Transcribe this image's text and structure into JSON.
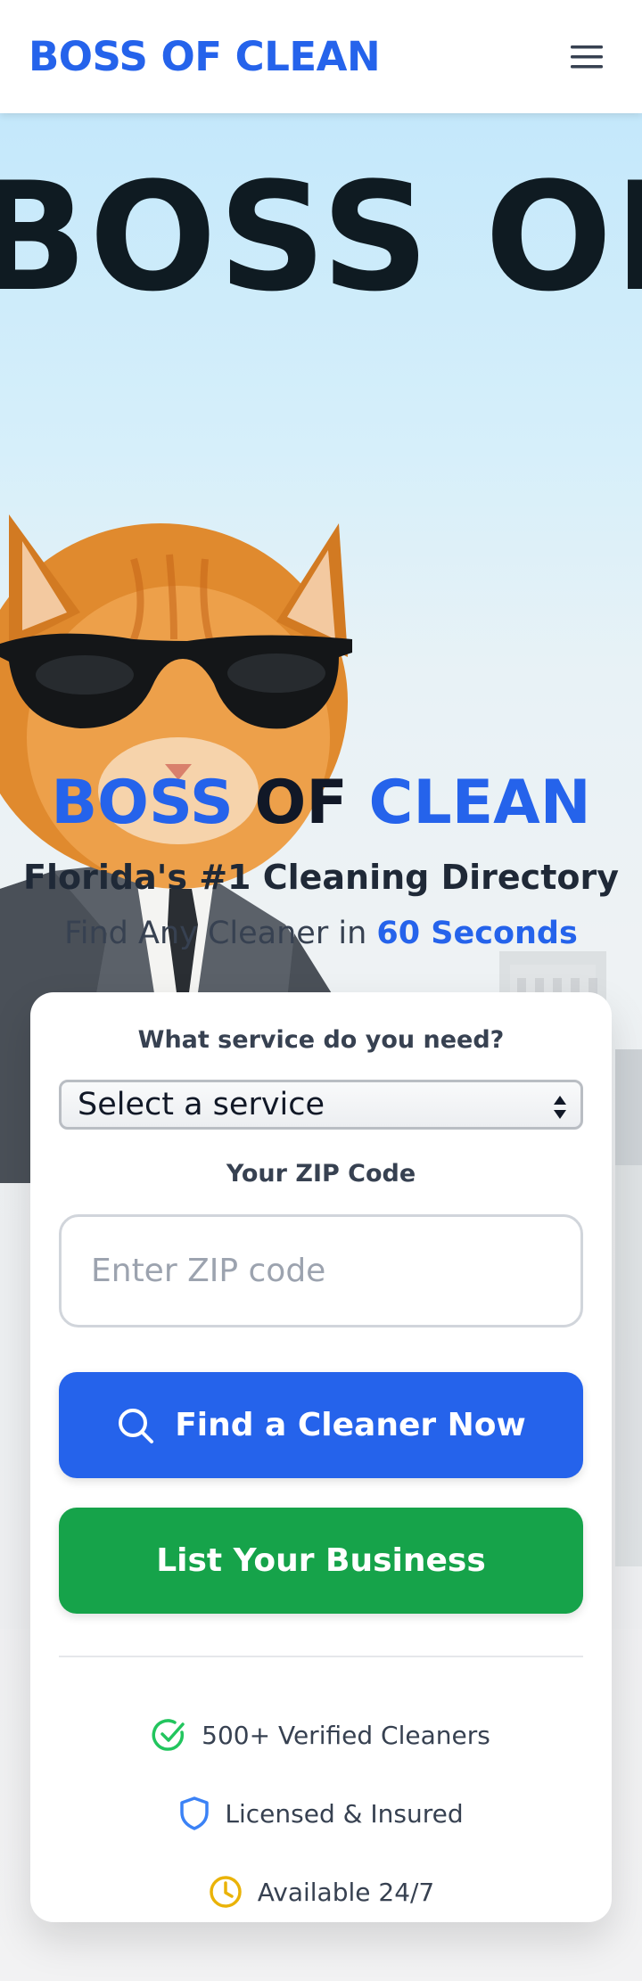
{
  "header": {
    "brand": "BOSS OF CLEAN",
    "menu_icon": "hamburger-menu-icon"
  },
  "hero": {
    "marquee_text": "BOSS OF CLEAN",
    "title_part1": "BOSS",
    "title_part2": " OF ",
    "title_part3": "CLEAN",
    "subtitle": "Florida's #1 Cleaning Directory",
    "tagline_prefix": "Find Any Cleaner in ",
    "tagline_highlight": "60 Seconds"
  },
  "form": {
    "service_label": "What service do you need?",
    "service_selected": "Select a service",
    "zip_label": "Your ZIP Code",
    "zip_placeholder": "Enter ZIP code",
    "zip_value": "",
    "find_button": "Find a Cleaner Now",
    "find_icon": "search-icon",
    "list_button": "List Your Business"
  },
  "features": [
    {
      "icon": "check-circle-icon",
      "text": "500+ Verified Cleaners"
    },
    {
      "icon": "shield-icon",
      "text": "Licensed & Insured"
    },
    {
      "icon": "clock-icon",
      "text": "Available 24/7"
    }
  ],
  "colors": {
    "brand_blue": "#2563eb",
    "cta_green": "#16a34a",
    "check_green": "#22c55e",
    "clock_yellow": "#eab308"
  }
}
